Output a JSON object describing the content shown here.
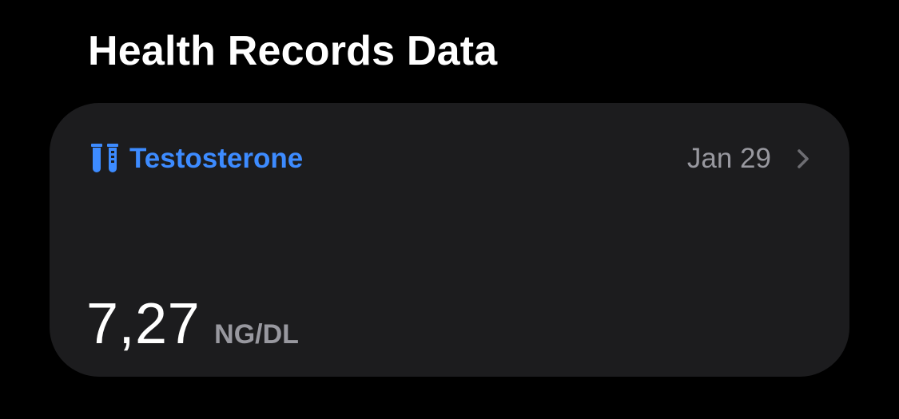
{
  "section": {
    "title": "Health Records Data"
  },
  "record": {
    "icon": "test-tubes-icon",
    "name": "Testosterone",
    "date": "Jan 29",
    "value": "7,27",
    "unit": "NG/DL"
  },
  "colors": {
    "background": "#000000",
    "card": "#1c1c1e",
    "accent": "#3d8bff",
    "secondary_text": "#98989f",
    "primary_text": "#ffffff"
  }
}
